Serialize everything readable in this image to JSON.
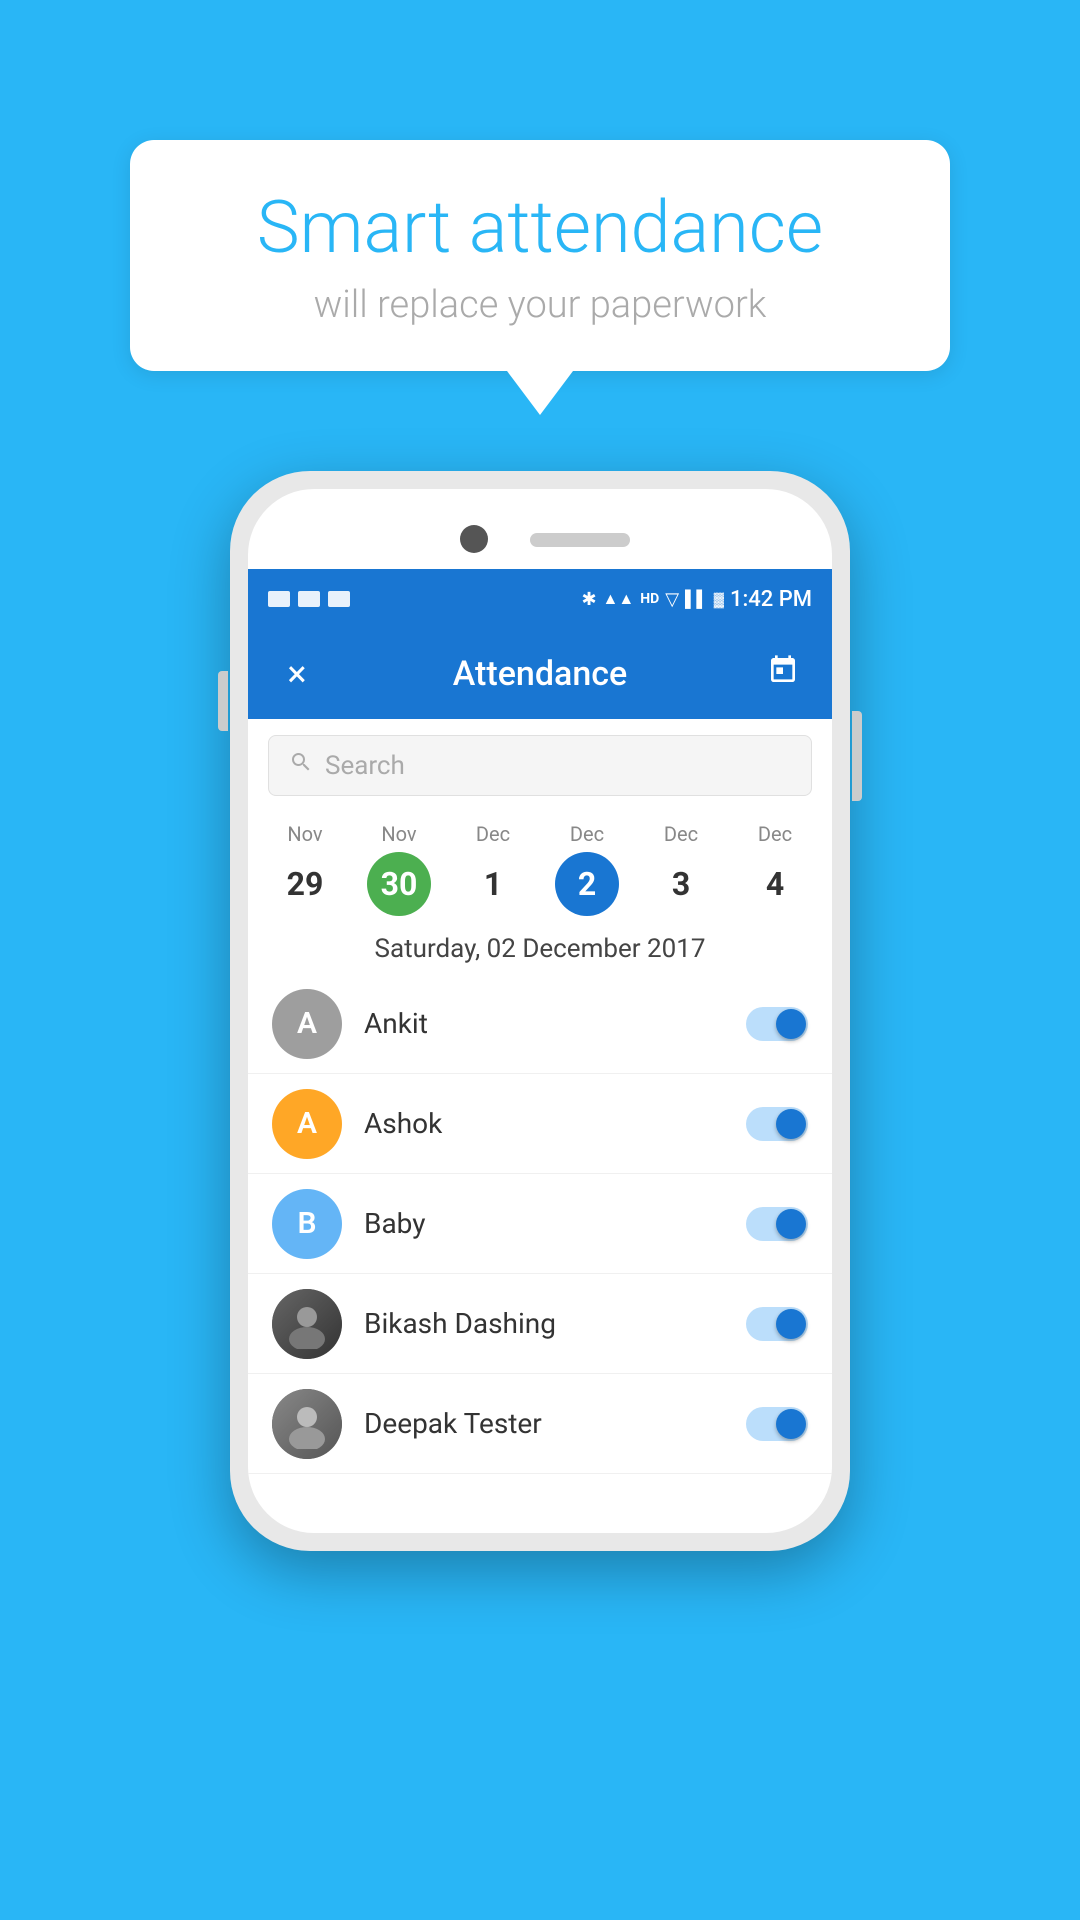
{
  "bubble": {
    "title": "Smart attendance",
    "subtitle": "will replace your paperwork"
  },
  "status_bar": {
    "time": "1:42 PM"
  },
  "app_bar": {
    "title": "Attendance",
    "close_label": "×",
    "calendar_label": "📅"
  },
  "search": {
    "placeholder": "Search"
  },
  "calendar": {
    "days": [
      {
        "month": "Nov",
        "num": "29",
        "style": "normal"
      },
      {
        "month": "Nov",
        "num": "30",
        "style": "green"
      },
      {
        "month": "Dec",
        "num": "1",
        "style": "normal"
      },
      {
        "month": "Dec",
        "num": "2",
        "style": "blue"
      },
      {
        "month": "Dec",
        "num": "3",
        "style": "normal"
      },
      {
        "month": "Dec",
        "num": "4",
        "style": "normal"
      }
    ],
    "selected_date": "Saturday, 02 December 2017"
  },
  "students": [
    {
      "name": "Ankit",
      "avatar_type": "letter",
      "letter": "A",
      "color": "gray",
      "present": true
    },
    {
      "name": "Ashok",
      "avatar_type": "letter",
      "letter": "A",
      "color": "orange",
      "present": true
    },
    {
      "name": "Baby",
      "avatar_type": "letter",
      "letter": "B",
      "color": "blue",
      "present": true
    },
    {
      "name": "Bikash Dashing",
      "avatar_type": "photo",
      "letter": "",
      "color": "",
      "present": true
    },
    {
      "name": "Deepak Tester",
      "avatar_type": "photo2",
      "letter": "",
      "color": "",
      "present": true
    }
  ]
}
